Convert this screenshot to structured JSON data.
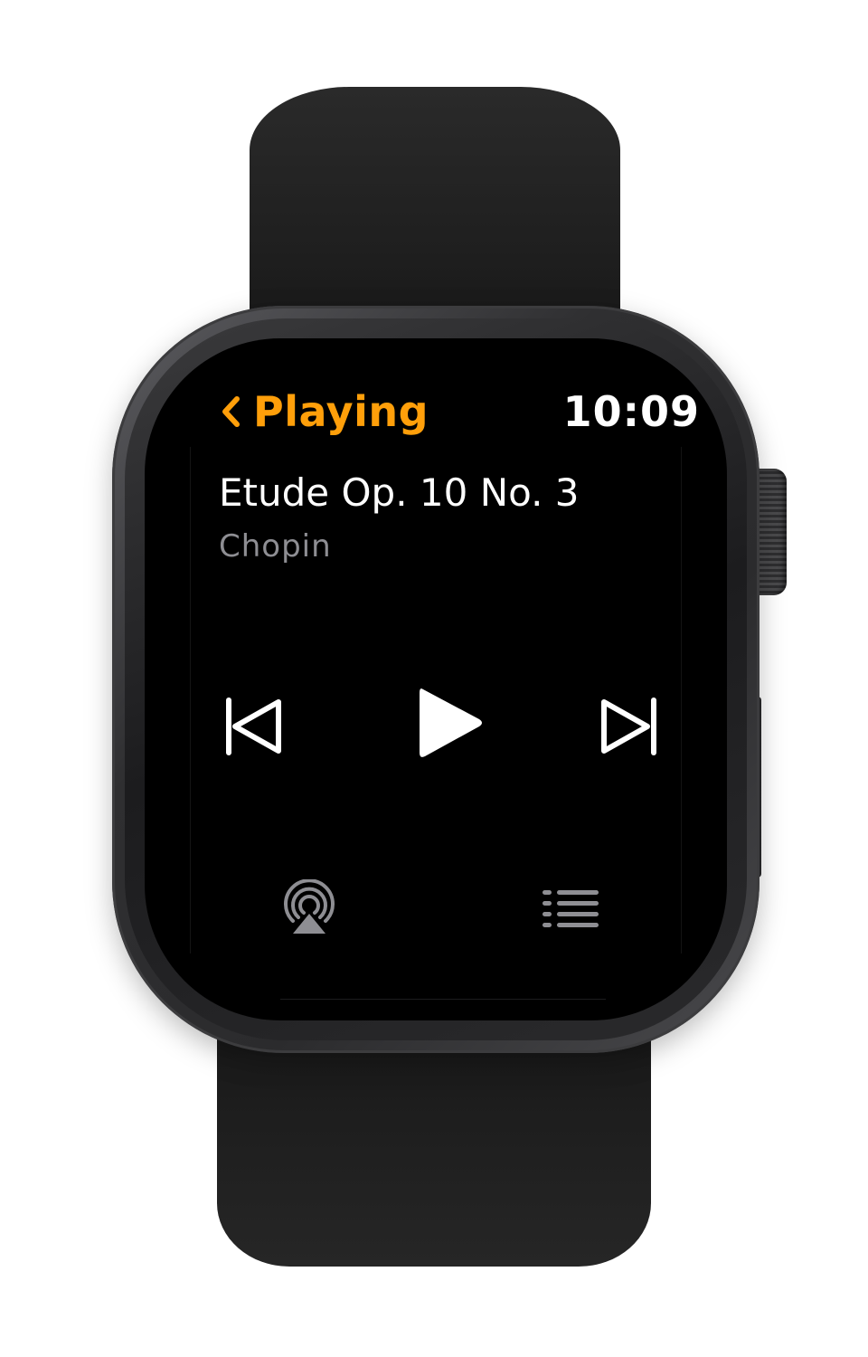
{
  "header": {
    "back_label": "Playing",
    "time": "10:09"
  },
  "now_playing": {
    "title": "Etude Op. 10 No. 3",
    "artist": "Chopin"
  },
  "controls": {
    "previous_icon": "skip-back-icon",
    "play_icon": "play-icon",
    "next_icon": "skip-forward-icon"
  },
  "footer": {
    "airplay_icon": "airplay-icon",
    "queue_icon": "list-icon"
  },
  "colors": {
    "accent": "#ff9f0a",
    "primary_text": "#ffffff",
    "secondary_text": "#8e8e93",
    "screen_background": "#000000"
  }
}
